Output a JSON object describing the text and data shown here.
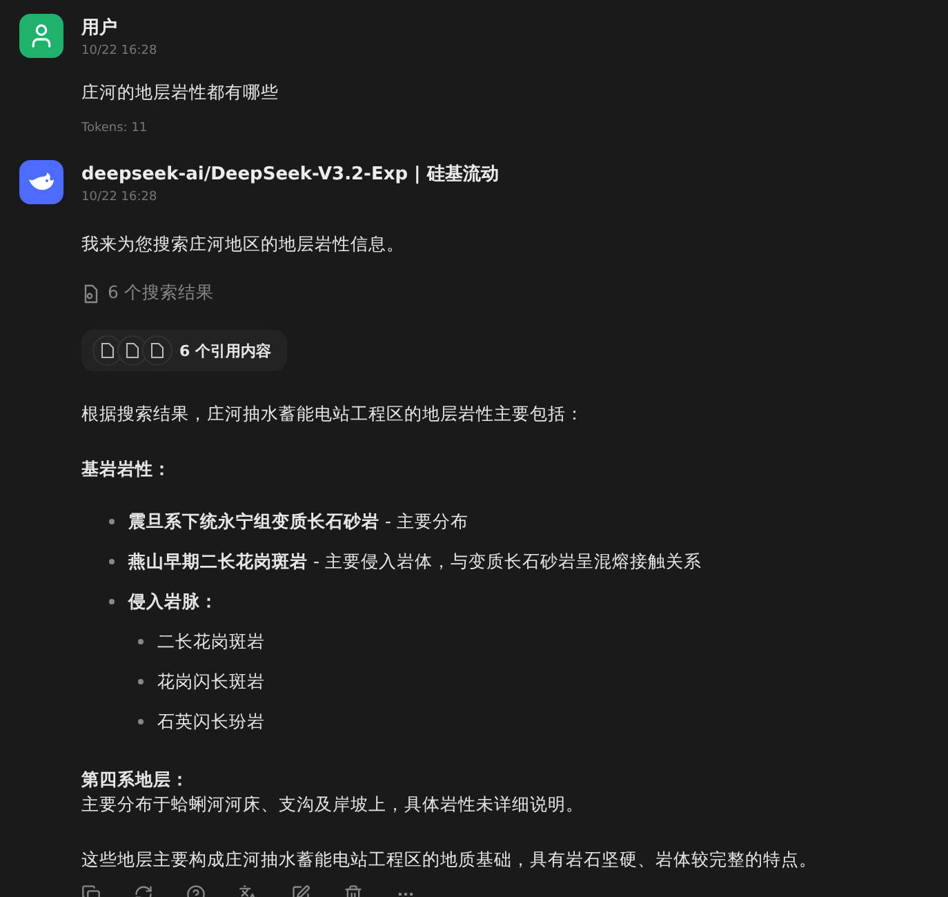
{
  "messages": [
    {
      "kind": "user",
      "author": "用户",
      "time": "10/22 16:28",
      "text": "庄河的地层岩性都有哪些",
      "tokens": "Tokens: 11"
    },
    {
      "kind": "assistant",
      "author": "deepseek-ai/DeepSeek-V3.2-Exp | 硅基流动",
      "time": "10/22 16:28",
      "blocks": [
        {
          "kind": "paragraph",
          "text": "我来为您搜索庄河地区的地层岩性信息。"
        },
        {
          "kind": "search",
          "text": "6 个搜索结果"
        },
        {
          "kind": "citations",
          "text": "6 个引用内容"
        },
        {
          "kind": "paragraph",
          "text": "根据搜索结果，庄河抽水蓄能电站工程区的地层岩性主要包括："
        },
        {
          "kind": "heading",
          "text": "基岩岩性："
        },
        {
          "kind": "list",
          "items": [
            {
              "term": "震旦系下统永宁组变质长石砂岩",
              "desc": " - 主要分布"
            },
            {
              "term": "燕山早期二长花岗斑岩",
              "desc": " - 主要侵入岩体，与变质长石砂岩呈混熔接触关系"
            },
            {
              "term": "侵入岩脉：",
              "children": [
                {
                  "text": "二长花岗斑岩"
                },
                {
                  "text": "花岗闪长斑岩"
                },
                {
                  "text": "石英闪长玢岩"
                }
              ]
            }
          ]
        },
        {
          "kind": "heading_tight",
          "text": "第四系地层："
        },
        {
          "kind": "paragraph",
          "text": "主要分布于蛤蜊河河床、支沟及岸坡上，具体岩性未详细说明。"
        },
        {
          "kind": "paragraph",
          "text": "这些地层主要构成庄河抽水蓄能电站工程区的地质基础，具有岩石坚硬、岩体较完整的特点。"
        },
        {
          "kind": "toolbar"
        }
      ]
    }
  ]
}
